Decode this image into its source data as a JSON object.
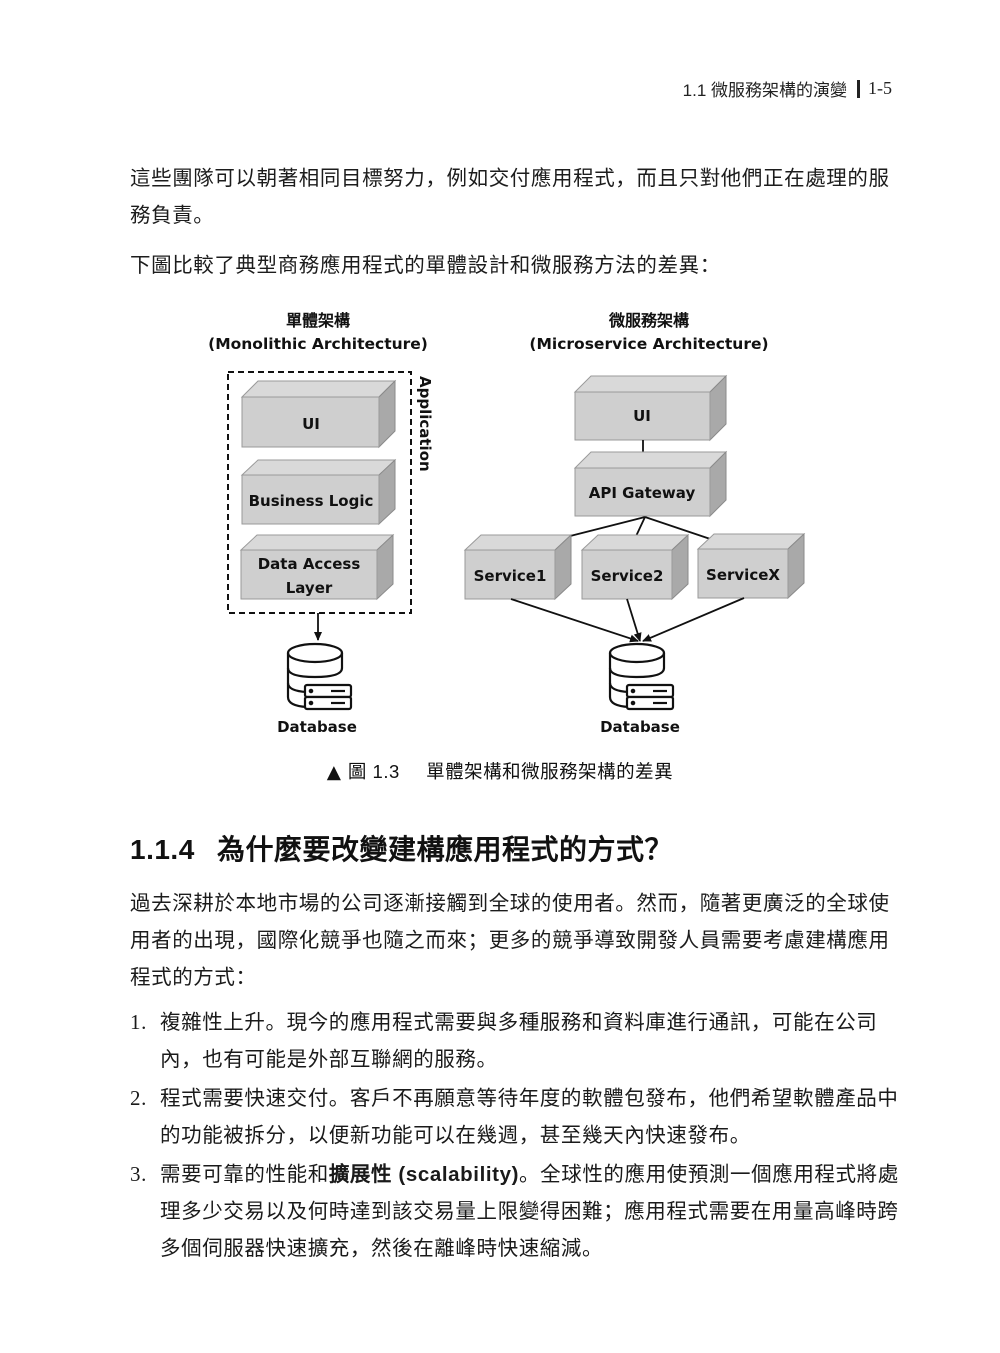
{
  "running_head": {
    "section": "1.1  微服務架構的演變",
    "page": "1-5"
  },
  "intro": {
    "para1": "這些團隊可以朝著相同目標努力，例如交付應用程式，而且只對他們正在處理的服務負責。",
    "para2": "下圖比較了典型商務應用程式的單體設計和微服務方法的差異："
  },
  "figure": {
    "monolithic": {
      "title_zh": "單體架構",
      "title_en": "(Monolithic Architecture)",
      "container_label": "Application",
      "layers": [
        "UI",
        "Business Logic",
        "Data Access",
        "Layer"
      ],
      "database_label": "Database",
      "database_icon": "database-icon"
    },
    "microservice": {
      "title_zh": "微服務架構",
      "title_en": "(Microservice Architecture)",
      "ui_label": "UI",
      "gateway_label": "API Gateway",
      "services": [
        "Service1",
        "Service2",
        "ServiceX"
      ],
      "database_label": "Database",
      "database_icon": "database-icon"
    },
    "caption_marker": "▲",
    "caption_number": "圖 1.3",
    "caption_text": "單體架構和微服務架構的差異"
  },
  "section": {
    "number": "1.1.4",
    "title": "為什麼要改變建構應用程式的方式？",
    "para": "過去深耕於本地市場的公司逐漸接觸到全球的使用者。然而，隨著更廣泛的全球使用者的出現，國際化競爭也隨之而來；更多的競爭導致開發人員需要考慮建構應用程式的方式：",
    "items": [
      {
        "num": "1.",
        "text": "複雜性上升。現今的應用程式需要與多種服務和資料庫進行通訊，可能在公司內，也有可能是外部互聯網的服務。"
      },
      {
        "num": "2.",
        "text": "程式需要快速交付。客戶不再願意等待年度的軟體包發布，他們希望軟體產品中的功能被拆分，以便新功能可以在幾週，甚至幾天內快速發布。"
      },
      {
        "num": "3.",
        "pre": "需要可靠的性能和",
        "bold": "擴展性",
        "bold_en": " (scalability)",
        "text": "。全球性的應用使預測一個應用程式將處理多少交易以及何時達到該交易量上限變得困難；應用程式需要在用量高峰時跨多個伺服器快速擴充，然後在離峰時快速縮減。"
      }
    ]
  }
}
